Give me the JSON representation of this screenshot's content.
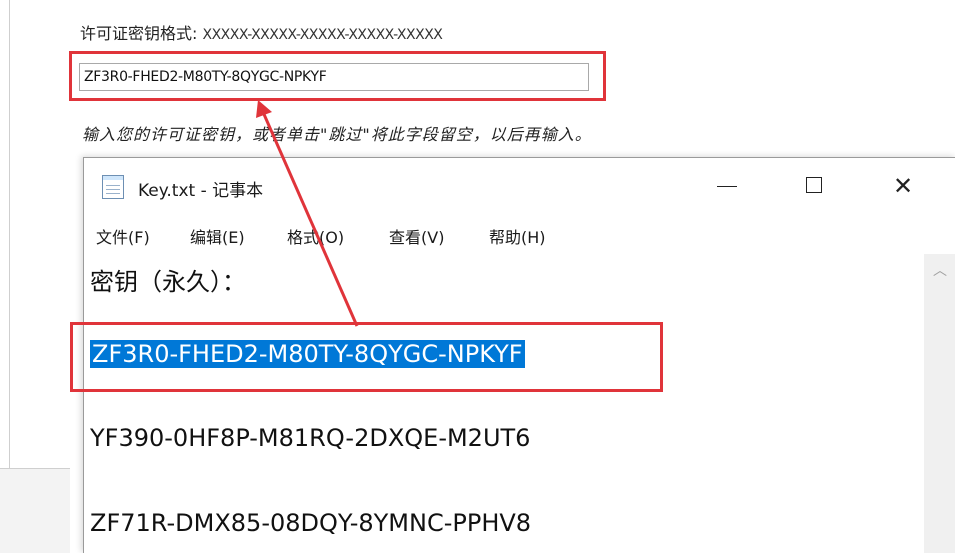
{
  "dialog": {
    "format_label": "许可证密钥格式: ",
    "format_mask": "XXXXX-XXXXX-XXXXX-XXXXX-XXXXX",
    "key_value": "ZF3R0-FHED2-M80TY-8QYGC-NPKYF",
    "hint": "输入您的许可证密钥，或者单击\"跳过\"将此字段留空，以后再输入。"
  },
  "notepad": {
    "title": "Key.txt - 记事本",
    "menu": [
      "文件(F)",
      "编辑(E)",
      "格式(O)",
      "查看(V)",
      "帮助(H)"
    ],
    "lines": {
      "heading": "密钥（永久）：",
      "selected_key": "ZF3R0-FHED2-M80TY-8QYGC-NPKYF",
      "key2": "YF390-0HF8P-M81RQ-2DXQE-M2UT6",
      "key3": "ZF71R-DMX85-08DQY-8YMNC-PPHV8"
    },
    "controls": {
      "minimize": "—",
      "close": "✕"
    }
  },
  "colors": {
    "highlight_border": "#e0343a",
    "selection": "#0078d7"
  }
}
